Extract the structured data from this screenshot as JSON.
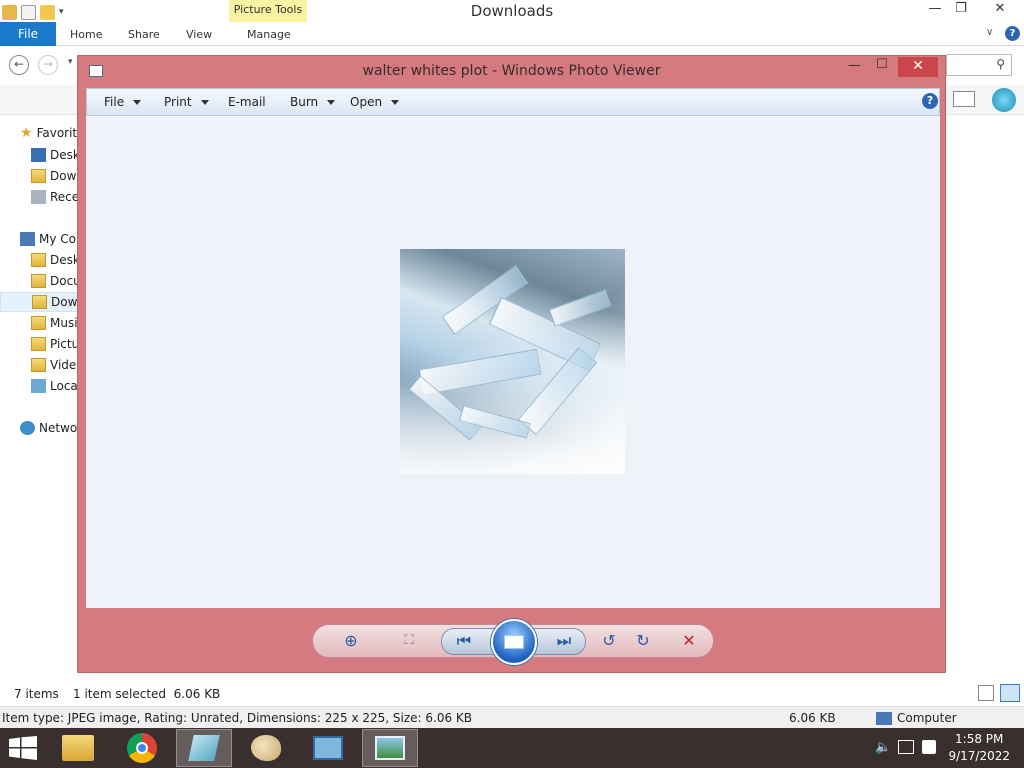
{
  "explorer": {
    "window_title": "Downloads",
    "contextual_tab": "Picture Tools",
    "tabs": [
      "File",
      "Home",
      "Share",
      "View",
      "Manage"
    ],
    "nav_items": [
      "Favorit",
      "Desk",
      "Dowr",
      "Rece",
      "My Co",
      "Desk",
      "Docu",
      "Dowr",
      "Musi",
      "Pictu",
      "Vide",
      "Loca",
      "Netwo"
    ],
    "status": {
      "items": "7 items",
      "selected": "1 item selected  6.06 KB"
    },
    "details": {
      "info": "Item type: JPEG image, Rating: Unrated, Dimensions: 225 x 225, Size: 6.06 KB",
      "size": "6.06 KB",
      "location": "Computer"
    }
  },
  "viewer": {
    "title": "walter whites plot - Windows Photo Viewer",
    "menu": {
      "file": "File",
      "print": "Print",
      "email": "E-mail",
      "burn": "Burn",
      "open": "Open"
    },
    "help": "?"
  },
  "taskbar": {
    "time": "1:58 PM",
    "date": "9/17/2022"
  },
  "icons": [
    "search-icon",
    "help-icon",
    "minimize-icon",
    "maximize-icon",
    "close-icon",
    "zoom-icon",
    "fit-icon",
    "previous-icon",
    "slideshow-icon",
    "next-icon",
    "rotate-left-icon",
    "rotate-right-icon",
    "delete-icon"
  ],
  "colors": {
    "accent": "#1979ca",
    "viewer_frame": "#d57b80",
    "close": "#c9474b"
  }
}
